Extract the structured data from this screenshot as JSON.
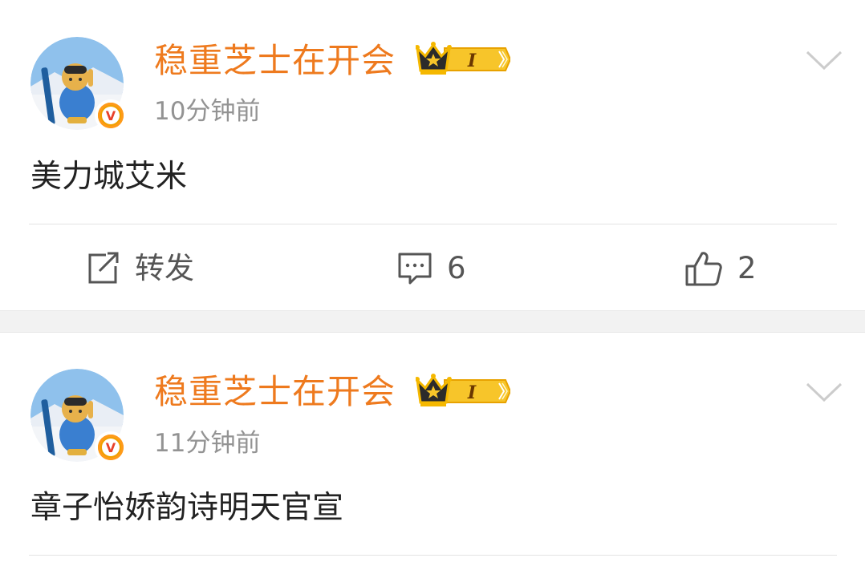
{
  "posts": [
    {
      "username": "稳重芝士在开会",
      "vip_level": "I",
      "timestamp": "10分钟前",
      "content": "美力城艾米",
      "actions": {
        "repost_label": "转发",
        "comment_count": "6",
        "like_count": "2"
      }
    },
    {
      "username": "稳重芝士在开会",
      "vip_level": "I",
      "timestamp": "11分钟前",
      "content": "章子怡娇韵诗明天官宣"
    }
  ],
  "colors": {
    "username": "#ee7a1e",
    "timestamp": "#939393",
    "content": "#222222",
    "separator": "#f2f2f2",
    "vip_gold": "#f5b800",
    "verified": "#f0a000"
  },
  "icons": {
    "verified": "verified-v-icon",
    "vip": "crown-vip-icon",
    "more": "chevron-down-icon",
    "repost": "share-icon",
    "comment": "comment-icon",
    "like": "thumbs-up-icon"
  }
}
